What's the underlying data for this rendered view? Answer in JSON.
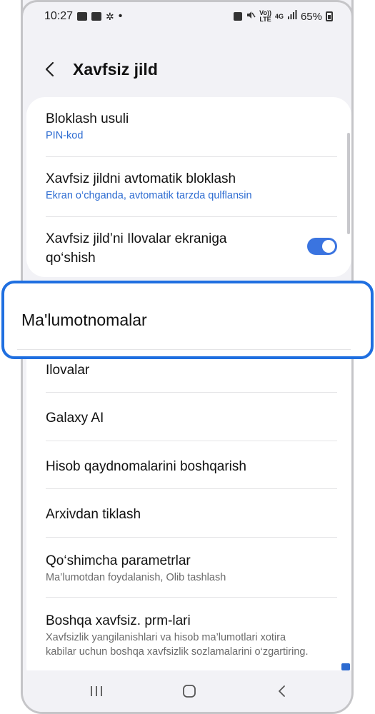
{
  "status_bar": {
    "time": "10:27",
    "dot": "•",
    "volte": "Vo))",
    "lte": "LTE",
    "network": "4G",
    "battery": "65%"
  },
  "header": {
    "title": "Xavfsiz jild"
  },
  "settings_top": [
    {
      "title": "Bloklash usuli",
      "subtitle": "PIN-kod"
    },
    {
      "title": "Xavfsiz jildni avtomatik bloklash",
      "subtitle": "Ekran o‘chganda, avtomatik tarzda qulflansin"
    },
    {
      "title_line1": "Xavfsiz jild’ni Ilovalar ekraniga",
      "title_line2": "qo‘shish",
      "toggle_on": true
    }
  ],
  "highlight": {
    "label": "Ma'lumotnomalar"
  },
  "settings_bottom": [
    {
      "title": "Ilovalar"
    },
    {
      "title": "Galaxy AI"
    },
    {
      "title": "Hisob qaydnomalarini boshqarish"
    },
    {
      "title": "Arxivdan tiklash"
    },
    {
      "title": "Qo‘shimcha parametrlar",
      "subtitle": "Ma’lumotdan foydalanish, Olib tashlash"
    },
    {
      "title": "Boshqa xavfsiz. prm-lari",
      "subtitle_line1": "Xavfsizlik yangilanishlari va hisob ma’lumotlari xotira",
      "subtitle_line2": "kabilar uchun boshqa xavfsizlik sozlamalarini o‘zgartiring."
    }
  ],
  "colors": {
    "accent": "#3a74e0",
    "highlight_border": "#1f6fe0",
    "link": "#2c6bd1"
  }
}
